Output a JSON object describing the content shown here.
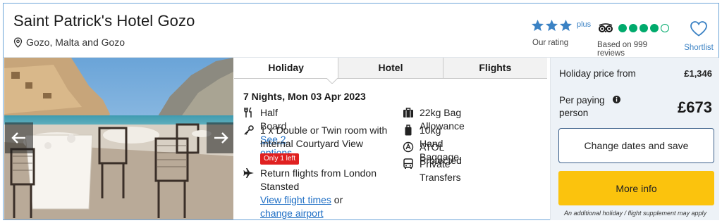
{
  "hotel": {
    "name": "Saint Patrick's Hotel Gozo",
    "location": "Gozo, Malta and Gozo"
  },
  "rating": {
    "stars": 3,
    "plus": "plus",
    "label": "Our rating"
  },
  "tripadvisor": {
    "score": 4,
    "out_of": 5,
    "label": "Based on 999 reviews"
  },
  "shortlist": {
    "label": "Shortlist"
  },
  "tabs": [
    {
      "label": "Holiday",
      "active": true
    },
    {
      "label": "Hotel",
      "active": false
    },
    {
      "label": "Flights",
      "active": false
    }
  ],
  "details": {
    "nights": "7 Nights, Mon 03 Apr 2023",
    "board": "Half Board",
    "board_link": "See 2 options",
    "room_line1": "1 x Double or Twin room with",
    "room_line2": "Internal Courtyard View",
    "room_badge": "Only 1 left",
    "flights_line1": "Return flights from London",
    "flights_line2": "Stansted",
    "flight_times_link": "View flight times",
    "or_text": "or",
    "change_airport_link": "change airport",
    "bag": "22kg Bag Allowance",
    "hand_baggage": "10kg Hand Baggage",
    "atol": "ATOL Protected",
    "transfers": "Private Transfers"
  },
  "price": {
    "holiday_label": "Holiday price from",
    "holiday_value": "£1,346",
    "per_person_label": "Per paying person",
    "per_person_value": "£673",
    "change_button": "Change dates and save",
    "more_button": "More info",
    "supplement_note": "An additional holiday / flight supplement may apply"
  },
  "colors": {
    "star": "#3b82c4",
    "tripadvisor": "#00aa6c",
    "more_info_button": "#fbc30d",
    "badge": "#e02020",
    "link": "#1f6fc5"
  }
}
